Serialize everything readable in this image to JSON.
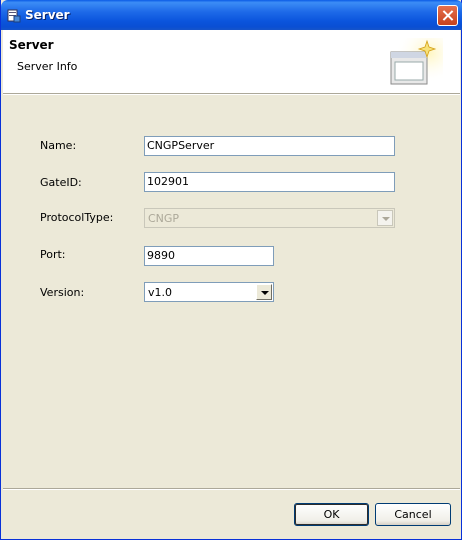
{
  "window": {
    "title": "Server"
  },
  "banner": {
    "title": "Server",
    "description": "Server Info"
  },
  "form": {
    "name": {
      "label": "Name:",
      "value": "CNGPServer"
    },
    "gateid": {
      "label": "GateID:",
      "value": "102901"
    },
    "protocol_type": {
      "label": "ProtocolType:",
      "value": "CNGP",
      "disabled": true
    },
    "port": {
      "label": "Port:",
      "value": "9890"
    },
    "version": {
      "label": "Version:",
      "value": "v1.0"
    }
  },
  "buttons": {
    "ok": "OK",
    "cancel": "Cancel"
  },
  "icons": {
    "window": "window-server-icon",
    "close": "close-icon",
    "banner": "wizard-window-icon",
    "dropdown": "chevron-down-icon"
  },
  "colors": {
    "titlebar": "#0a54e3",
    "background": "#ece9d8",
    "field_border": "#7f9db9"
  }
}
